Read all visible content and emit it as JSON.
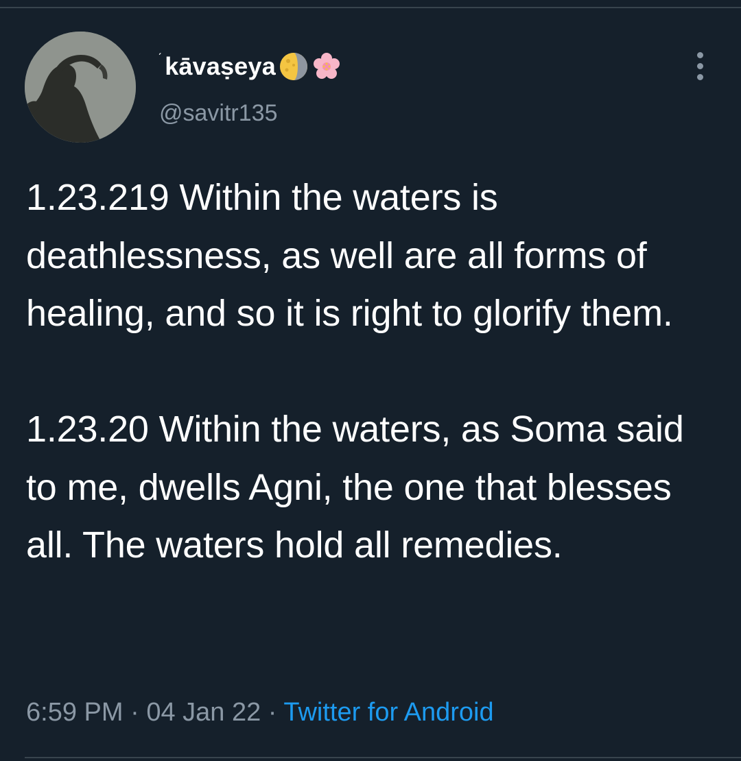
{
  "tweet": {
    "author": {
      "name_mark": "ˊ",
      "display_name": "kāvaṣeya",
      "emojis": [
        "moon-icon",
        "cherry-blossom-icon"
      ],
      "handle": "@savitr135"
    },
    "text_paragraphs": [
      "1.23.219 Within the waters is deathlessness, as well are all forms of healing, and so it is right to glorify them.",
      "1.23.20 Within the waters, as Soma said to me, dwells Agni, the one that blesses all. The waters hold all remedies."
    ],
    "time": "6:59 PM",
    "separator": " · ",
    "date": "04 Jan 22",
    "source": "Twitter for Android"
  },
  "colors": {
    "background": "#15202b",
    "text": "#ffffff",
    "secondary": "#8b98a5",
    "link": "#1d9bf0",
    "divider": "#38444d"
  }
}
